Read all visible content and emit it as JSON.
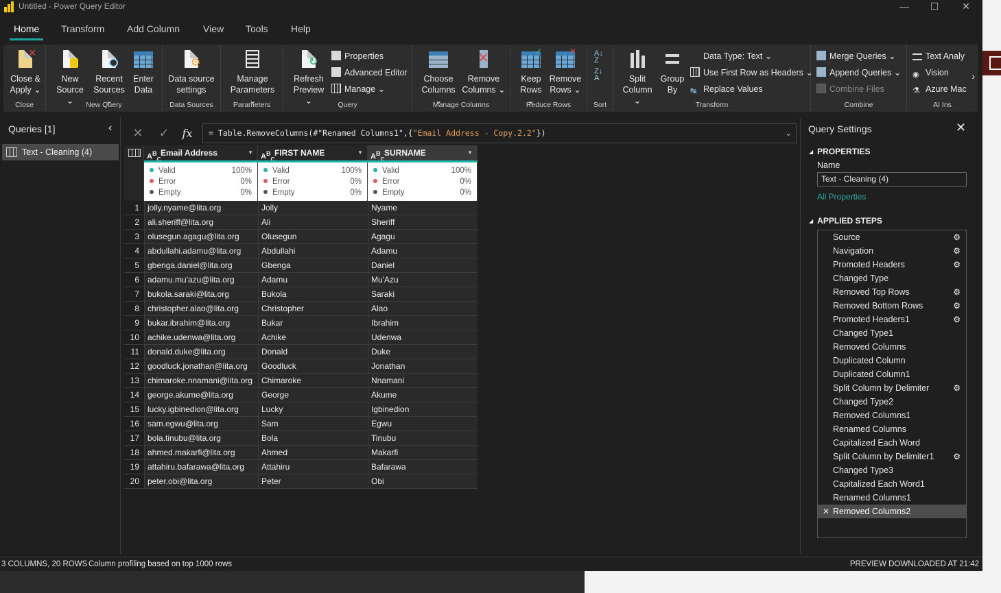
{
  "window": {
    "title": "Untitled - Power Query Editor",
    "minimize": "—",
    "maximize": "☐",
    "close": "✕"
  },
  "menu_tabs": [
    "Home",
    "Transform",
    "Add Column",
    "View",
    "Tools",
    "Help"
  ],
  "ribbon": {
    "close_group": {
      "label": "Close",
      "close_apply": [
        "Close &",
        "Apply ⌄"
      ]
    },
    "new_query_group": {
      "label": "New Query",
      "new_source": [
        "New",
        "Source ⌄"
      ],
      "recent_sources": [
        "Recent",
        "Sources ⌄"
      ],
      "enter_data": [
        "Enter",
        "Data"
      ]
    },
    "data_sources_group": {
      "label": "Data Sources",
      "ds_settings": [
        "Data source",
        "settings"
      ]
    },
    "parameters_group": {
      "label": "Parameters",
      "manage_params": [
        "Manage",
        "Parameters ⌄"
      ]
    },
    "query_group": {
      "label": "Query",
      "refresh_preview": [
        "Refresh",
        "Preview ⌄"
      ],
      "properties": "Properties",
      "advanced_editor": "Advanced Editor",
      "manage": "Manage ⌄"
    },
    "manage_columns_group": {
      "label": "Manage Columns",
      "choose_columns": [
        "Choose",
        "Columns ⌄"
      ],
      "remove_columns": [
        "Remove",
        "Columns ⌄"
      ]
    },
    "reduce_rows_group": {
      "label": "Reduce Rows",
      "keep_rows": [
        "Keep",
        "Rows ⌄"
      ],
      "remove_rows": [
        "Remove",
        "Rows ⌄"
      ]
    },
    "sort_group": {
      "label": "Sort"
    },
    "transform_group": {
      "label": "Transform",
      "split_column": [
        "Split",
        "Column ⌄"
      ],
      "group_by": [
        "Group",
        "By"
      ],
      "data_type": "Data Type: Text ⌄",
      "first_row_headers": "Use First Row as Headers ⌄",
      "replace_values": "Replace Values"
    },
    "combine_group": {
      "label": "Combine",
      "merge_queries": "Merge Queries ⌄",
      "append_queries": "Append Queries ⌄",
      "combine_files": "Combine Files"
    },
    "ai_group": {
      "label": "AI Ins",
      "text_analytics": "Text Analy",
      "vision": "Vision",
      "azure_ml": "Azure Mac"
    }
  },
  "queries": {
    "header": "Queries [1]",
    "items": [
      "Text - Cleaning (4)"
    ]
  },
  "formula": {
    "prefix": "= Table.RemoveColumns(#\"Renamed Columns1\",{",
    "string": "\"Email Address - Copy.2.2\"",
    "suffix": "})"
  },
  "columns": [
    {
      "type": "ABC",
      "name": "Email Address",
      "valid": "100%",
      "error": "0%",
      "empty": "0%"
    },
    {
      "type": "ABC",
      "name": "FIRST NAME",
      "valid": "100%",
      "error": "0%",
      "empty": "0%"
    },
    {
      "type": "ABC",
      "name": "SURNAME",
      "valid": "100%",
      "error": "0%",
      "empty": "0%"
    }
  ],
  "profile_labels": {
    "valid": "Valid",
    "error": "Error",
    "empty": "Empty"
  },
  "rows": [
    [
      "1",
      "jolly.nyame@lita.org",
      "Jolly",
      "Nyame"
    ],
    [
      "2",
      "ali.sheriff@lita.org",
      "Ali",
      "Sheriff"
    ],
    [
      "3",
      "olusegun.agagu@lita.org",
      "Olusegun",
      "Agagu"
    ],
    [
      "4",
      "abdullahi.adamu@lita.org",
      "Abdullahi",
      "Adamu"
    ],
    [
      "5",
      "gbenga.daniel@lita.org",
      "Gbenga",
      "Daniel"
    ],
    [
      "6",
      "adamu.mu'azu@lita.org",
      "Adamu",
      "Mu'Azu"
    ],
    [
      "7",
      "bukola.saraki@lita.org",
      "Bukola",
      "Saraki"
    ],
    [
      "8",
      "christopher.alao@lita.org",
      "Christopher",
      "Alao"
    ],
    [
      "9",
      "bukar.ibrahim@lita.org",
      "Bukar",
      "Ibrahim"
    ],
    [
      "10",
      "achike.udenwa@lita.org",
      "Achike",
      "Udenwa"
    ],
    [
      "11",
      "donald.duke@lita.org",
      "Donald",
      "Duke"
    ],
    [
      "12",
      "goodluck.jonathan@lita.org",
      "Goodluck",
      "Jonathan"
    ],
    [
      "13",
      "chimaroke.nnamani@lita.org",
      "Chimaroke",
      "Nnamani"
    ],
    [
      "14",
      "george.akume@lita.org",
      "George",
      "Akume"
    ],
    [
      "15",
      "lucky.igbinedion@lita.org",
      "Lucky",
      "Igbinedion"
    ],
    [
      "16",
      "sam.egwu@lita.org",
      "Sam",
      "Egwu"
    ],
    [
      "17",
      "bola.tinubu@lita.org",
      "Bola",
      "Tinubu"
    ],
    [
      "18",
      "ahmed.makarfi@lita.org",
      "Ahmed",
      "Makarfi"
    ],
    [
      "19",
      "attahiru.bafarawa@lita.org",
      "Attahiru",
      "Bafarawa"
    ],
    [
      "20",
      "peter.obi@lita.org",
      "Peter",
      "Obi"
    ]
  ],
  "settings": {
    "title": "Query Settings",
    "properties_header": "PROPERTIES",
    "name_label": "Name",
    "name_value": "Text - Cleaning (4)",
    "all_properties": "All Properties",
    "applied_steps_header": "APPLIED STEPS",
    "steps": [
      {
        "name": "Source",
        "gear": true
      },
      {
        "name": "Navigation",
        "gear": true
      },
      {
        "name": "Promoted Headers",
        "gear": true
      },
      {
        "name": "Changed Type",
        "gear": false
      },
      {
        "name": "Removed Top Rows",
        "gear": true
      },
      {
        "name": "Removed Bottom Rows",
        "gear": true
      },
      {
        "name": "Promoted Headers1",
        "gear": true
      },
      {
        "name": "Changed Type1",
        "gear": false
      },
      {
        "name": "Removed Columns",
        "gear": false
      },
      {
        "name": "Duplicated Column",
        "gear": false
      },
      {
        "name": "Duplicated Column1",
        "gear": false
      },
      {
        "name": "Split Column by Delimiter",
        "gear": true
      },
      {
        "name": "Changed Type2",
        "gear": false
      },
      {
        "name": "Removed Columns1",
        "gear": false
      },
      {
        "name": "Renamed Columns",
        "gear": false
      },
      {
        "name": "Capitalized Each Word",
        "gear": false
      },
      {
        "name": "Split Column by Delimiter1",
        "gear": true
      },
      {
        "name": "Changed Type3",
        "gear": false
      },
      {
        "name": "Capitalized Each Word1",
        "gear": false
      },
      {
        "name": "Renamed Columns1",
        "gear": false
      },
      {
        "name": "Removed Columns2",
        "gear": false,
        "active": true
      }
    ]
  },
  "status": {
    "counts": "3 COLUMNS, 20 ROWS",
    "profiling": "Column profiling based on top 1000 rows",
    "downloaded": "PREVIEW DOWNLOADED AT 21:42"
  },
  "colors": {
    "accent": "#1fb2a8",
    "valid": "#1fb2a8",
    "error": "#e05a5a",
    "empty": "#555555",
    "brand": "#f2c811"
  }
}
